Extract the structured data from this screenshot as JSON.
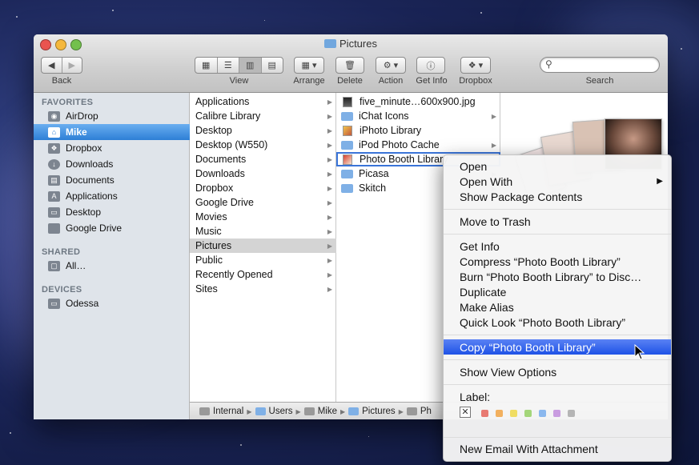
{
  "window": {
    "title": "Pictures"
  },
  "toolbar": {
    "back_label": "Back",
    "view_label": "View",
    "arrange_label": "Arrange",
    "delete_label": "Delete",
    "action_label": "Action",
    "getinfo_label": "Get Info",
    "dropbox_label": "Dropbox",
    "search_label": "Search",
    "search_placeholder": ""
  },
  "sidebar": {
    "favorites_header": "FAVORITES",
    "favorites": [
      {
        "label": "AirDrop",
        "icon": "airdrop-icon"
      },
      {
        "label": "Mike",
        "icon": "home-icon",
        "selected": true
      },
      {
        "label": "Dropbox",
        "icon": "dropbox-icon"
      },
      {
        "label": "Downloads",
        "icon": "downloads-icon"
      },
      {
        "label": "Documents",
        "icon": "documents-icon"
      },
      {
        "label": "Applications",
        "icon": "applications-icon"
      },
      {
        "label": "Desktop",
        "icon": "desktop-icon"
      },
      {
        "label": "Google Drive",
        "icon": "folder-icon"
      }
    ],
    "shared_header": "SHARED",
    "shared": [
      {
        "label": "All…",
        "icon": "network-icon"
      }
    ],
    "devices_header": "DEVICES",
    "devices": [
      {
        "label": "Odessa",
        "icon": "disk-icon"
      }
    ]
  },
  "column1": [
    "Applications",
    "Calibre Library",
    "Desktop",
    "Desktop (W550)",
    "Documents",
    "Downloads",
    "Dropbox",
    "Google Drive",
    "Movies",
    "Music",
    "Pictures",
    "Public",
    "Recently Opened",
    "Sites"
  ],
  "column1_selected": "Pictures",
  "column2": [
    {
      "label": "five_minute…600x900.jpg",
      "icon": "image-file-icon",
      "arrow": false
    },
    {
      "label": "iChat Icons",
      "icon": "folder-icon",
      "arrow": true
    },
    {
      "label": "iPhoto Library",
      "icon": "iphoto-icon",
      "arrow": false
    },
    {
      "label": "iPod Photo Cache",
      "icon": "folder-icon",
      "arrow": true
    },
    {
      "label": "Photo Booth Library",
      "icon": "photobooth-icon",
      "arrow": false
    },
    {
      "label": "Picasa",
      "icon": "folder-icon",
      "arrow": true
    },
    {
      "label": "Skitch",
      "icon": "folder-icon",
      "arrow": true
    }
  ],
  "pathbar": [
    "Internal",
    "Users",
    "Mike",
    "Pictures",
    "Ph"
  ],
  "context_menu": {
    "group1": [
      "Open",
      "Open With",
      "Show Package Contents"
    ],
    "group2": [
      "Move to Trash"
    ],
    "group3": [
      "Get Info",
      "Compress “Photo Booth Library”",
      "Burn “Photo Booth Library” to Disc…",
      "Duplicate",
      "Make Alias",
      "Quick Look “Photo Booth Library”"
    ],
    "highlighted": "Copy “Photo Booth Library”",
    "group5": [
      "Show View Options"
    ],
    "label_title": "Label:",
    "label_colors": [
      "#e87a72",
      "#f2b05e",
      "#f0dd63",
      "#a4d67a",
      "#8bb8ee",
      "#c99ce0",
      "#b5b5b5"
    ],
    "group7": [
      "New Email With Attachment"
    ]
  },
  "colors": {
    "accent": "#2d7fd6",
    "menu_highlight": "#1e52e6"
  }
}
